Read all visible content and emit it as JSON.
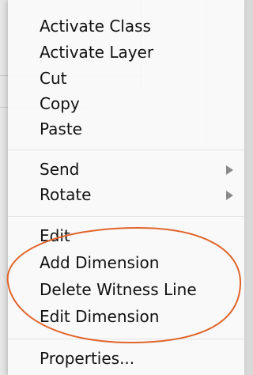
{
  "menu": {
    "group1": {
      "activate_class": "Activate Class",
      "activate_layer": "Activate Layer",
      "cut": "Cut",
      "copy": "Copy",
      "paste": "Paste"
    },
    "group2": {
      "send": "Send",
      "rotate": "Rotate"
    },
    "group3": {
      "edit": "Edit",
      "add_dimension": "Add Dimension",
      "delete_witness_line": "Delete Witness Line",
      "edit_dimension": "Edit Dimension"
    },
    "group4": {
      "properties": "Properties..."
    }
  },
  "icons": {
    "submenu": "triangle-right-icon"
  },
  "colors": {
    "annotation_ellipse": "#e0642a",
    "menu_text": "#111111",
    "submenu_arrow": "#8a8a8a"
  }
}
